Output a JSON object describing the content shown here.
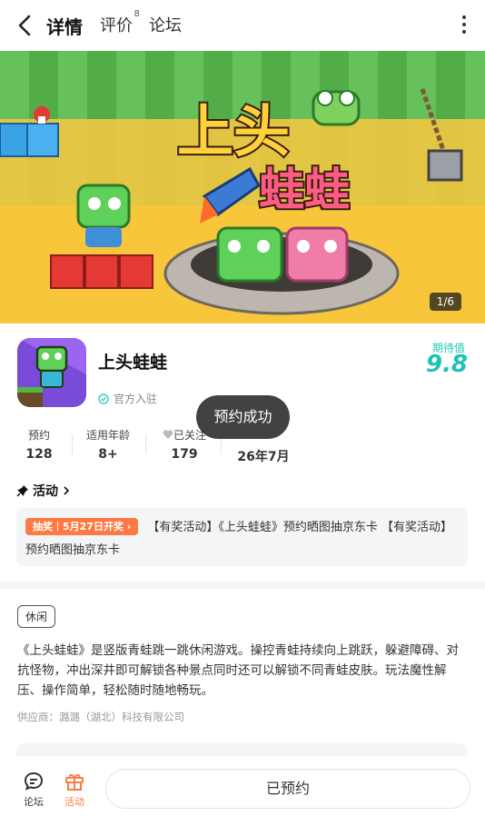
{
  "nav": {
    "tabs": [
      {
        "label": "详情"
      },
      {
        "label": "评价",
        "badge": "8"
      },
      {
        "label": "论坛"
      }
    ]
  },
  "banner": {
    "title_line1": "上头",
    "title_line2": "蛙蛙",
    "counter": "1/6"
  },
  "game": {
    "name": "上头蛙蛙",
    "official": "官方入驻",
    "expect_label": "期待值",
    "expect_score": "9.8"
  },
  "stats": [
    {
      "label": "预约",
      "value": "128"
    },
    {
      "label": "适用年龄",
      "value": "8+"
    },
    {
      "label": "已关注",
      "value": "179"
    },
    {
      "label": "",
      "value": "26年7月"
    }
  ],
  "toast": "预约成功",
  "activity": {
    "heading": "活动",
    "badge": "抽奖｜5月27日开奖",
    "text": "【有奖活动】《上头蛙蛙》预约晒图抽京东卡 【有奖活动】预约晒图抽京东卡"
  },
  "tag": "休闲",
  "description": "《上头蛙蛙》是竖版青蛙跳一跳休闲游戏。操控青蛙持续向上跳跃，躲避障碍、对抗怪物，冲出深井即可解锁各种景点同时还可以解锁不同青蛙皮肤。玩法魔性解压、操作简单，轻松随时随地畅玩。",
  "supplier": "供应商：潞潞（湖北）科技有限公司",
  "bottom": {
    "forum": "论坛",
    "activity": "活动",
    "reserve": "已预约"
  },
  "colors": {
    "accent": "#1fc3b4",
    "activity_orange": "#fe7a45"
  },
  "icons": [
    "back-arrow-icon",
    "more-icon",
    "verified-icon",
    "pin-icon",
    "chevron-right-icon",
    "forum-icon",
    "gift-icon"
  ]
}
